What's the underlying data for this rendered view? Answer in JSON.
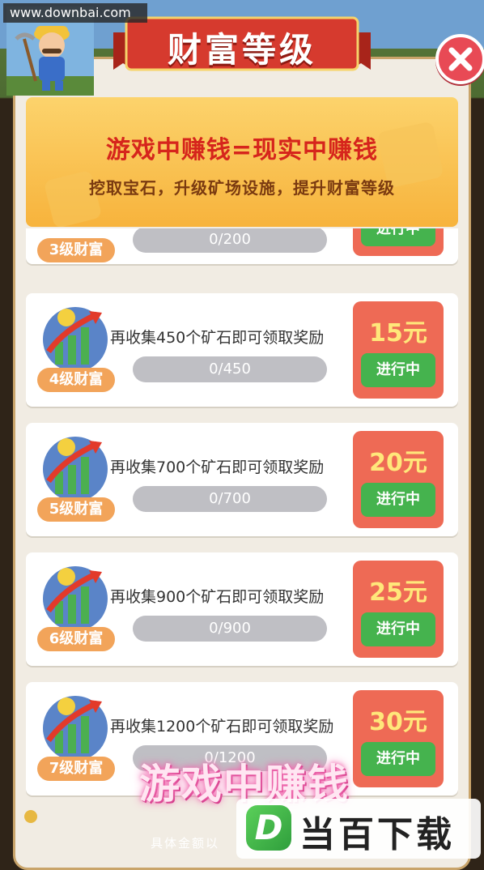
{
  "watermark": "www.downbai.com",
  "title": "财富等级",
  "banner": {
    "title": "游戏中赚钱=现实中赚钱",
    "subtitle": "挖取宝石，升级矿场设施，提升财富等级"
  },
  "levels": [
    {
      "level_label": "3级财富",
      "task": "",
      "progress_text": "0/200",
      "progress": 0,
      "reward": "",
      "status": "进行中"
    },
    {
      "level_label": "4级财富",
      "task": "再收集450个矿石即可领取奖励",
      "progress_text": "0/450",
      "progress": 0,
      "reward": "15元",
      "status": "进行中"
    },
    {
      "level_label": "5级财富",
      "task": "再收集700个矿石即可领取奖励",
      "progress_text": "0/700",
      "progress": 0,
      "reward": "20元",
      "status": "进行中"
    },
    {
      "level_label": "6级财富",
      "task": "再收集900个矿石即可领取奖励",
      "progress_text": "0/900",
      "progress": 0,
      "reward": "25元",
      "status": "进行中"
    },
    {
      "level_label": "7级财富",
      "task": "再收集1200个矿石即可领取奖励",
      "progress_text": "0/1200",
      "progress": 0,
      "reward": "30元",
      "status": "进行中"
    }
  ],
  "overlay_text": "游戏中赚钱",
  "subtitle_text": "具体金额以",
  "brand": {
    "logo_letter": "D",
    "name": "当百下载"
  },
  "icons": {
    "close": "close-icon",
    "level": "money-growth-chart-icon",
    "avatar": "miner-avatar-icon"
  },
  "colors": {
    "reward_bg": "#ee6a55",
    "status_green": "#45b34e",
    "banner_gold": "#f7b33c",
    "ribbon_red": "#d63a2e"
  }
}
